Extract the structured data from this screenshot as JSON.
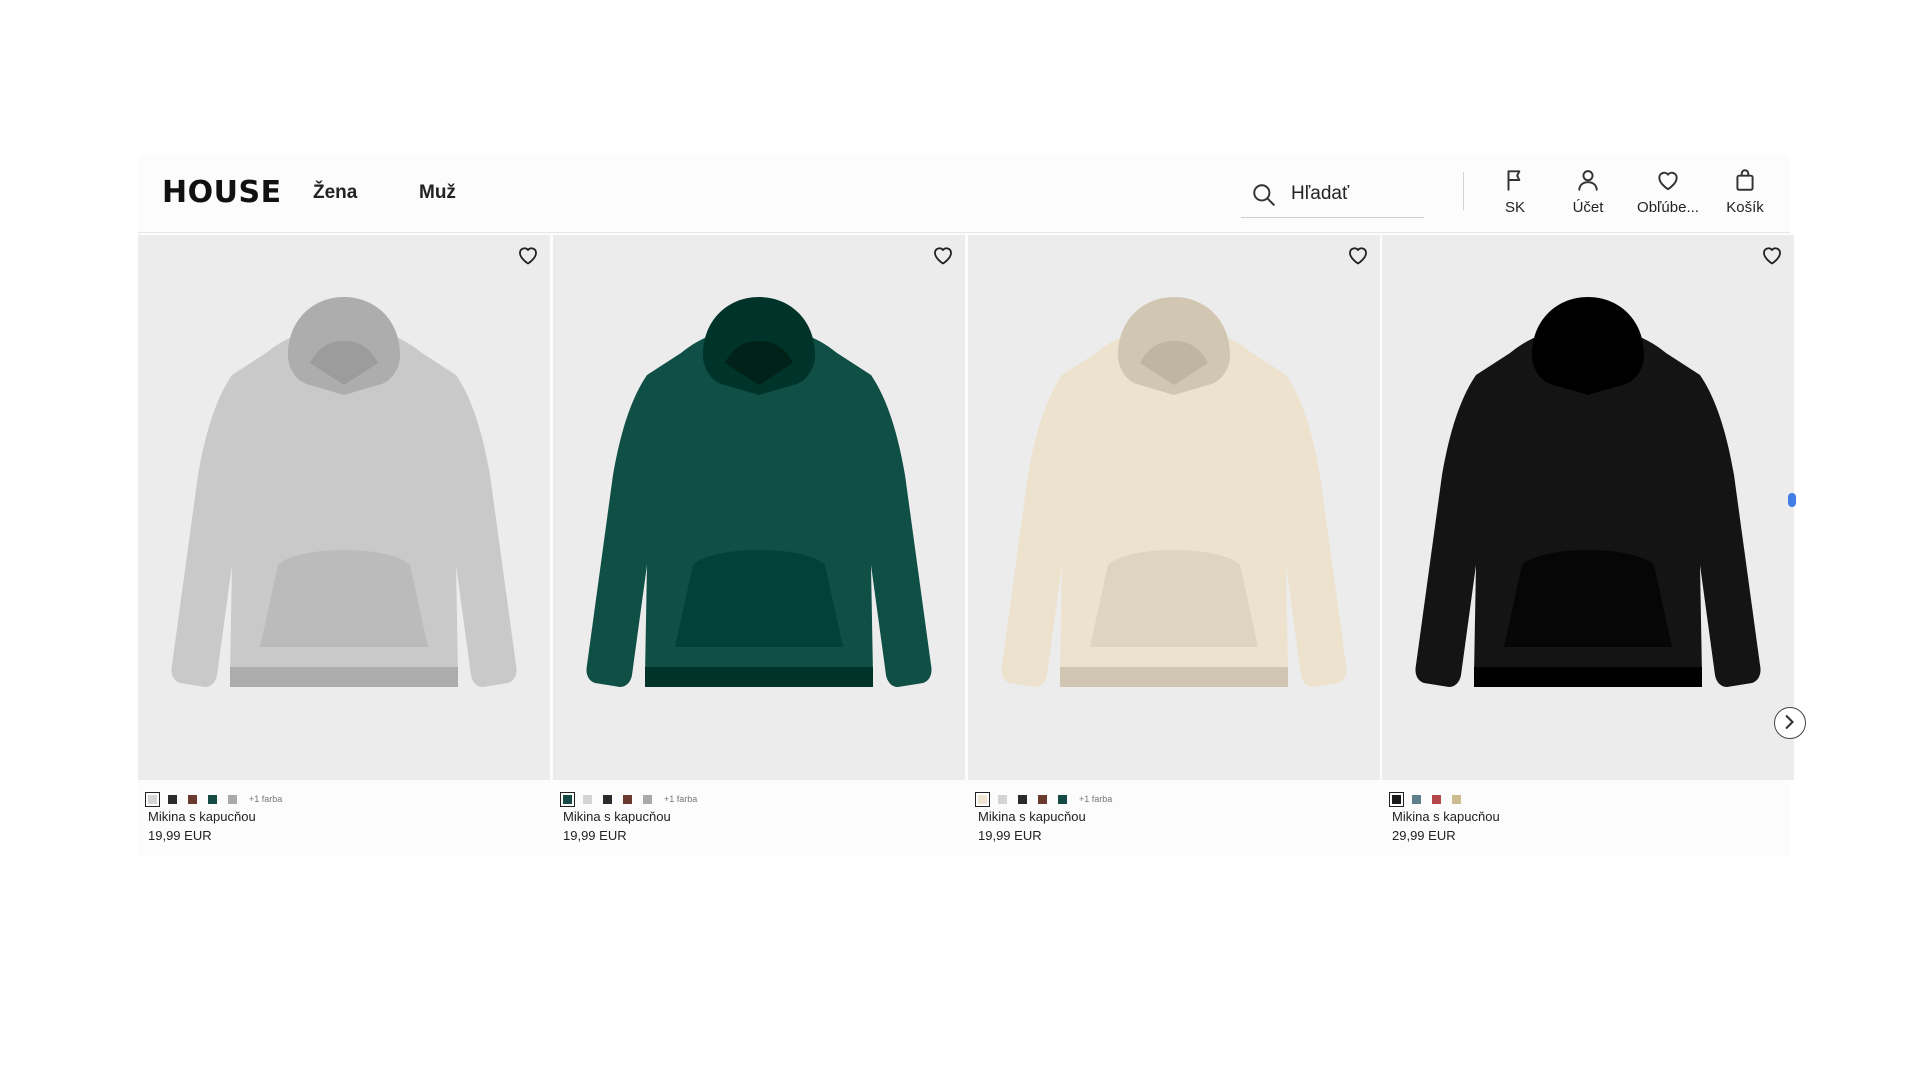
{
  "header": {
    "logo": "HOUSE",
    "nav": [
      "Žena",
      "Muž"
    ],
    "search": {
      "placeholder": "Hľadať",
      "icon": "search-icon"
    },
    "actions": [
      {
        "label": "SK",
        "icon": "flag-icon"
      },
      {
        "label": "Účet",
        "icon": "user-icon"
      },
      {
        "label": "Obľúbe...",
        "icon": "heart-icon"
      },
      {
        "label": "Košík",
        "icon": "bag-icon"
      }
    ]
  },
  "products": [
    {
      "name": "Mikina s kapucňou",
      "price": "19,99 EUR",
      "color": "#c9c9c9",
      "swatches": [
        "#d4d4d4",
        "#2b2b2b",
        "#6b3a2e",
        "#164a44",
        "#a9a9a9"
      ],
      "more_colors": "+1 farba",
      "favorite_icon": "heart-icon"
    },
    {
      "name": "Mikina s kapucňou",
      "price": "19,99 EUR",
      "color": "#0f4f45",
      "swatches": [
        "#164a44",
        "#d4d4d4",
        "#2b2b2b",
        "#6b3a2e",
        "#a9a9a9"
      ],
      "more_colors": "+1 farba",
      "favorite_icon": "heart-icon"
    },
    {
      "name": "Mikina s kapucňou",
      "price": "19,99 EUR",
      "color": "#ede2cd",
      "swatches": [
        "#efe4d0",
        "#d4d4d4",
        "#2b2b2b",
        "#6b3a2e",
        "#164a44"
      ],
      "more_colors": "+1 farba",
      "favorite_icon": "heart-icon"
    },
    {
      "name": "Mikina s kapucňou",
      "price": "29,99 EUR",
      "color": "#141414",
      "swatches": [
        "#1a1a1a",
        "#5f7f8c",
        "#b5474a",
        "#cdbb92"
      ],
      "more_colors": "",
      "favorite_icon": "heart-icon"
    }
  ],
  "carousel": {
    "next_icon": "chevron-right-icon"
  }
}
